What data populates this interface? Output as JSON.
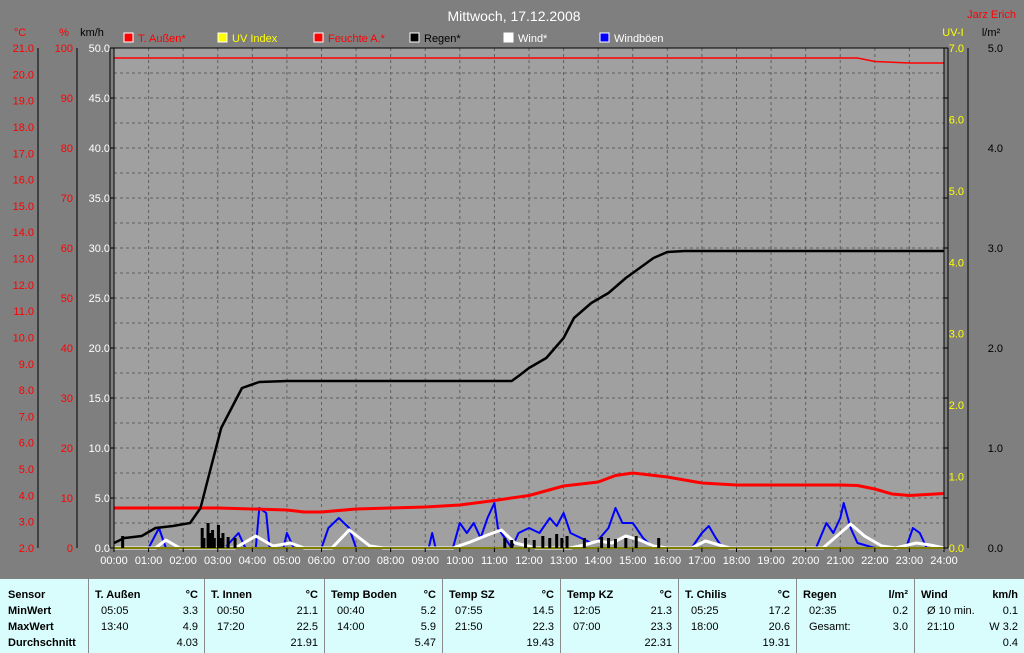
{
  "header": {
    "title": "Mittwoch, 17.12.2008",
    "author": "Jarz Erich"
  },
  "legend": [
    {
      "label": "T. Außen*",
      "color": "#ff0000",
      "text_color": "#ff0000"
    },
    {
      "label": "UV Index",
      "color": "#ffff00",
      "text_color": "#ffff00"
    },
    {
      "label": "Feuchte A.*",
      "color": "#ff0000",
      "text_color": "#ff0000"
    },
    {
      "label": "Regen*",
      "color": "#000000",
      "text_color": "#000000"
    },
    {
      "label": "Wind*",
      "color": "#ffffff",
      "text_color": "#ffffff"
    },
    {
      "label": "Windböen",
      "color": "#0000ff",
      "text_color": "#ffffff"
    }
  ],
  "axes": {
    "temp_unit": "°C",
    "hum_unit": "%",
    "wind_unit": "km/h",
    "uv_unit": "UV-I",
    "rain_unit": "l/m²",
    "temp_ticks": [
      "2.0",
      "3.0",
      "4.0",
      "5.0",
      "6.0",
      "7.0",
      "8.0",
      "9.0",
      "10.0",
      "11.0",
      "12.0",
      "13.0",
      "14.0",
      "15.0",
      "16.0",
      "17.0",
      "18.0",
      "19.0",
      "20.0",
      "21.0"
    ],
    "hum_ticks": [
      "0",
      "10",
      "20",
      "30",
      "40",
      "50",
      "60",
      "70",
      "80",
      "90",
      "100"
    ],
    "wind_ticks": [
      "0.0",
      "5.0",
      "10.0",
      "15.0",
      "20.0",
      "25.0",
      "30.0",
      "35.0",
      "40.0",
      "45.0",
      "50.0"
    ],
    "uv_ticks": [
      "0.0",
      "1.0",
      "2.0",
      "3.0",
      "4.0",
      "5.0",
      "6.0",
      "7.0"
    ],
    "rain_ticks": [
      "0.0",
      "1.0",
      "2.0",
      "3.0",
      "4.0",
      "5.0"
    ],
    "time_ticks": [
      "00:00",
      "01:00",
      "02:00",
      "03:00",
      "04:00",
      "05:00",
      "06:00",
      "07:00",
      "08:00",
      "09:00",
      "10:00",
      "11:00",
      "12:00",
      "13:00",
      "14:00",
      "15:00",
      "16:00",
      "17:00",
      "18:00",
      "19:00",
      "20:00",
      "21:00",
      "22:00",
      "23:00",
      "24:00"
    ]
  },
  "chart_data": {
    "type": "line",
    "xlim": [
      0,
      24
    ],
    "ylim_humidity": [
      0,
      100
    ],
    "ylim_wind": [
      0,
      50
    ],
    "ylim_rain": [
      0,
      5
    ],
    "grid": true,
    "series": [
      {
        "name": "Feuchte A.*",
        "axis": "humidity",
        "color": "#ff0000",
        "points": [
          [
            0,
            98
          ],
          [
            21.5,
            98
          ],
          [
            22,
            97.3
          ],
          [
            23,
            97
          ],
          [
            24,
            97
          ]
        ]
      },
      {
        "name": "T. Außen*",
        "axis": "humidity",
        "color": "#ff0000",
        "points": [
          [
            0,
            8
          ],
          [
            1,
            8
          ],
          [
            2,
            8
          ],
          [
            3,
            8
          ],
          [
            4,
            7.8
          ],
          [
            5,
            7.6
          ],
          [
            5.5,
            7.2
          ],
          [
            6,
            7.2
          ],
          [
            7,
            7.8
          ],
          [
            8,
            8
          ],
          [
            9,
            8.2
          ],
          [
            10,
            8.6
          ],
          [
            11,
            9.5
          ],
          [
            12,
            10.5
          ],
          [
            13,
            12.4
          ],
          [
            14,
            13.2
          ],
          [
            14.5,
            14.5
          ],
          [
            15,
            15
          ],
          [
            16,
            14.2
          ],
          [
            17,
            13
          ],
          [
            18,
            12.6
          ],
          [
            19,
            12.6
          ],
          [
            20,
            12.6
          ],
          [
            21,
            12.6
          ],
          [
            21.5,
            12.5
          ],
          [
            22,
            11.8
          ],
          [
            22.5,
            10.8
          ],
          [
            23,
            10.5
          ],
          [
            24,
            10.9
          ]
        ]
      },
      {
        "name": "Regen*",
        "axis": "rain",
        "color": "#000000",
        "points": [
          [
            0,
            0.05
          ],
          [
            0.3,
            0.1
          ],
          [
            0.8,
            0.12
          ],
          [
            1.2,
            0.2
          ],
          [
            1.7,
            0.22
          ],
          [
            2.2,
            0.25
          ],
          [
            2.5,
            0.4
          ],
          [
            2.8,
            0.8
          ],
          [
            3.1,
            1.2
          ],
          [
            3.4,
            1.4
          ],
          [
            3.7,
            1.6
          ],
          [
            4.2,
            1.66
          ],
          [
            5,
            1.67
          ],
          [
            10,
            1.67
          ],
          [
            11.5,
            1.67
          ],
          [
            11.7,
            1.72
          ],
          [
            12,
            1.8
          ],
          [
            12.5,
            1.9
          ],
          [
            13,
            2.1
          ],
          [
            13.3,
            2.3
          ],
          [
            13.8,
            2.45
          ],
          [
            14.3,
            2.55
          ],
          [
            14.8,
            2.7
          ],
          [
            15.2,
            2.8
          ],
          [
            15.6,
            2.9
          ],
          [
            16,
            2.96
          ],
          [
            16.5,
            2.97
          ],
          [
            24,
            2.97
          ]
        ]
      },
      {
        "name": "Windböen",
        "axis": "wind",
        "color": "#0000ff",
        "points": [
          [
            1,
            0
          ],
          [
            1.3,
            2
          ],
          [
            1.5,
            0
          ],
          [
            3.2,
            0
          ],
          [
            3.6,
            1.5
          ],
          [
            3.8,
            0
          ],
          [
            4.1,
            0
          ],
          [
            4.2,
            4
          ],
          [
            4.4,
            3.5
          ],
          [
            4.5,
            0
          ],
          [
            4.9,
            0
          ],
          [
            5,
            1.5
          ],
          [
            5.2,
            0
          ],
          [
            6,
            0
          ],
          [
            6.2,
            2
          ],
          [
            6.5,
            3
          ],
          [
            6.8,
            2
          ],
          [
            7,
            0
          ],
          [
            9.1,
            0
          ],
          [
            9.2,
            1.5
          ],
          [
            9.3,
            0
          ],
          [
            9.8,
            0
          ],
          [
            10,
            2.5
          ],
          [
            10.2,
            1.5
          ],
          [
            10.4,
            2.5
          ],
          [
            10.6,
            1
          ],
          [
            10.8,
            3
          ],
          [
            11,
            4.5
          ],
          [
            11.1,
            2
          ],
          [
            11.3,
            1
          ],
          [
            11.5,
            0
          ],
          [
            11.7,
            1.5
          ],
          [
            12,
            2
          ],
          [
            12.3,
            1.5
          ],
          [
            12.6,
            3
          ],
          [
            12.8,
            2.2
          ],
          [
            13,
            3.5
          ],
          [
            13.2,
            1.5
          ],
          [
            13.5,
            1
          ],
          [
            13.8,
            0.5
          ],
          [
            14,
            0.8
          ],
          [
            14.3,
            2
          ],
          [
            14.5,
            4
          ],
          [
            14.7,
            2.5
          ],
          [
            15,
            2.5
          ],
          [
            15.3,
            1
          ],
          [
            15.6,
            0
          ],
          [
            16.7,
            0
          ],
          [
            17,
            1.5
          ],
          [
            17.2,
            2.2
          ],
          [
            17.4,
            1
          ],
          [
            17.6,
            0
          ],
          [
            20.3,
            0
          ],
          [
            20.6,
            2.5
          ],
          [
            20.8,
            1.5
          ],
          [
            21,
            3
          ],
          [
            21.1,
            4.5
          ],
          [
            21.3,
            2
          ],
          [
            21.5,
            0.5
          ],
          [
            22,
            0
          ],
          [
            22.9,
            0
          ],
          [
            23.1,
            2
          ],
          [
            23.3,
            1.5
          ],
          [
            23.5,
            0
          ]
        ]
      },
      {
        "name": "Wind*",
        "axis": "wind",
        "color": "#ffffff",
        "points": [
          [
            0,
            0
          ],
          [
            1.2,
            0
          ],
          [
            1.5,
            0.8
          ],
          [
            1.9,
            0
          ],
          [
            3.5,
            0
          ],
          [
            4.1,
            1.2
          ],
          [
            4.6,
            0.2
          ],
          [
            5.1,
            0.5
          ],
          [
            5.5,
            0
          ],
          [
            6.3,
            0
          ],
          [
            6.8,
            1.8
          ],
          [
            7.4,
            0.2
          ],
          [
            7.8,
            0
          ],
          [
            9.8,
            0
          ],
          [
            10.3,
            0.6
          ],
          [
            10.8,
            1.3
          ],
          [
            11.2,
            1.8
          ],
          [
            11.6,
            0.5
          ],
          [
            12.2,
            0
          ],
          [
            13.2,
            0
          ],
          [
            13.6,
            0.3
          ],
          [
            14,
            0.7
          ],
          [
            14.4,
            0.5
          ],
          [
            14.8,
            1.2
          ],
          [
            15.2,
            0.8
          ],
          [
            15.6,
            0.2
          ],
          [
            16,
            0
          ],
          [
            16.7,
            0
          ],
          [
            17.1,
            0.7
          ],
          [
            17.5,
            0.3
          ],
          [
            17.8,
            0
          ],
          [
            20.5,
            0
          ],
          [
            21,
            1.5
          ],
          [
            21.3,
            2.4
          ],
          [
            21.7,
            1.2
          ],
          [
            22.2,
            0.2
          ],
          [
            22.6,
            0
          ],
          [
            23.2,
            0.5
          ],
          [
            23.6,
            0.3
          ],
          [
            24,
            0
          ]
        ]
      },
      {
        "name": "UV Index",
        "axis": "uv",
        "color": "#ffff00",
        "points": [
          [
            0,
            0
          ],
          [
            24,
            0
          ]
        ]
      }
    ],
    "rain_bars": {
      "axis": "wind",
      "color": "#000000",
      "bars": [
        [
          0.25,
          1.2
        ],
        [
          2.55,
          2
        ],
        [
          2.6,
          1
        ],
        [
          2.72,
          2.5
        ],
        [
          2.78,
          1.5
        ],
        [
          2.85,
          1.8
        ],
        [
          2.9,
          1
        ],
        [
          3.02,
          2.3
        ],
        [
          3.08,
          1
        ],
        [
          3.15,
          1.5
        ],
        [
          3.3,
          1.1
        ],
        [
          3.5,
          1
        ],
        [
          11.3,
          1
        ],
        [
          11.5,
          0.8
        ],
        [
          11.9,
          1
        ],
        [
          12.15,
          0.8
        ],
        [
          12.4,
          1.2
        ],
        [
          12.6,
          1
        ],
        [
          12.8,
          1.4
        ],
        [
          12.95,
          1
        ],
        [
          13.1,
          1.2
        ],
        [
          13.6,
          1
        ],
        [
          14.1,
          1.1
        ],
        [
          14.3,
          1
        ],
        [
          14.5,
          0.9
        ],
        [
          14.8,
          1
        ],
        [
          15.1,
          1.2
        ],
        [
          15.75,
          1
        ]
      ]
    }
  },
  "stats": {
    "sensor": {
      "header": "Sensor",
      "min": "MinWert",
      "max": "MaxWert",
      "avg": "Durchschnitt"
    },
    "sections": [
      {
        "name": "T. Außen",
        "unit": "°C",
        "min_time": "05:05",
        "min_val": "3.3",
        "max_time": "13:40",
        "max_val": "4.9",
        "avg": "4.03"
      },
      {
        "name": "T. Innen",
        "unit": "°C",
        "min_time": "00:50",
        "min_val": "21.1",
        "max_time": "17:20",
        "max_val": "22.5",
        "avg": "21.91"
      },
      {
        "name": "Temp Boden",
        "unit": "°C",
        "min_time": "00:40",
        "min_val": "5.2",
        "max_time": "14:00",
        "max_val": "5.9",
        "avg": "5.47"
      },
      {
        "name": "Temp SZ",
        "unit": "°C",
        "min_time": "07:55",
        "min_val": "14.5",
        "max_time": "21:50",
        "max_val": "22.3",
        "avg": "19.43"
      },
      {
        "name": "Temp KZ",
        "unit": "°C",
        "min_time": "12:05",
        "min_val": "21.3",
        "max_time": "07:00",
        "max_val": "23.3",
        "avg": "22.31"
      },
      {
        "name": "T. Chilis",
        "unit": "°C",
        "min_time": "05:25",
        "min_val": "17.2",
        "max_time": "18:00",
        "max_val": "20.6",
        "avg": "19.31"
      },
      {
        "name": "Regen",
        "unit": "l/m²",
        "min_time": "02:35",
        "min_val": "0.2",
        "max_time": "Gesamt:",
        "max_val": "3.0",
        "avg": ""
      },
      {
        "name": "Wind",
        "unit": "km/h",
        "min_time": "Ø 10 min.",
        "min_val": "0.1",
        "max_time": "21:10",
        "max_val": "W 3.2",
        "avg": "0.4"
      }
    ]
  }
}
